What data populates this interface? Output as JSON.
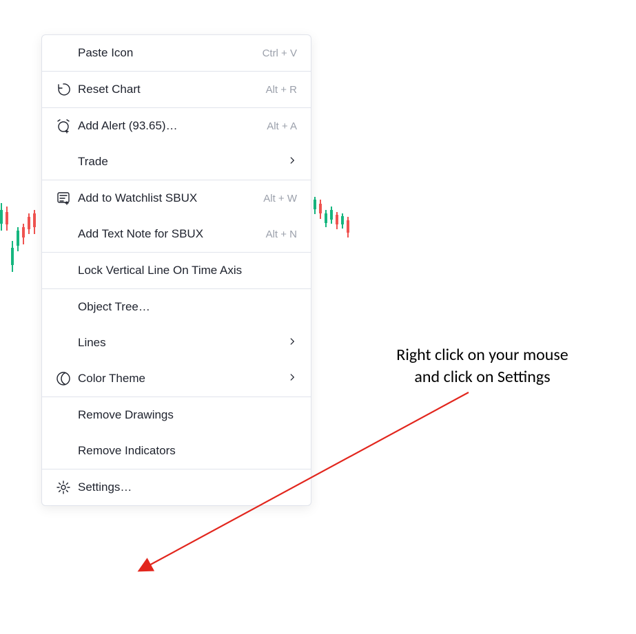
{
  "menu": {
    "paste": {
      "label": "Paste Icon",
      "shortcut": "Ctrl + V"
    },
    "reset": {
      "label": "Reset Chart",
      "shortcut": "Alt + R"
    },
    "alert": {
      "label": "Add Alert (93.65)…",
      "shortcut": "Alt + A"
    },
    "trade": {
      "label": "Trade"
    },
    "watchlist": {
      "label": "Add to Watchlist SBUX",
      "shortcut": "Alt + W"
    },
    "note": {
      "label": "Add Text Note for SBUX",
      "shortcut": "Alt + N"
    },
    "lock": {
      "label": "Lock Vertical Line On Time Axis"
    },
    "objtree": {
      "label": "Object Tree…"
    },
    "lines": {
      "label": "Lines"
    },
    "theme": {
      "label": "Color Theme"
    },
    "remdraw": {
      "label": "Remove Drawings"
    },
    "remind": {
      "label": "Remove Indicators"
    },
    "settings": {
      "label": "Settings…"
    }
  },
  "annotation": {
    "line1": "Right click on your mouse",
    "line2": "and click on Settings"
  }
}
